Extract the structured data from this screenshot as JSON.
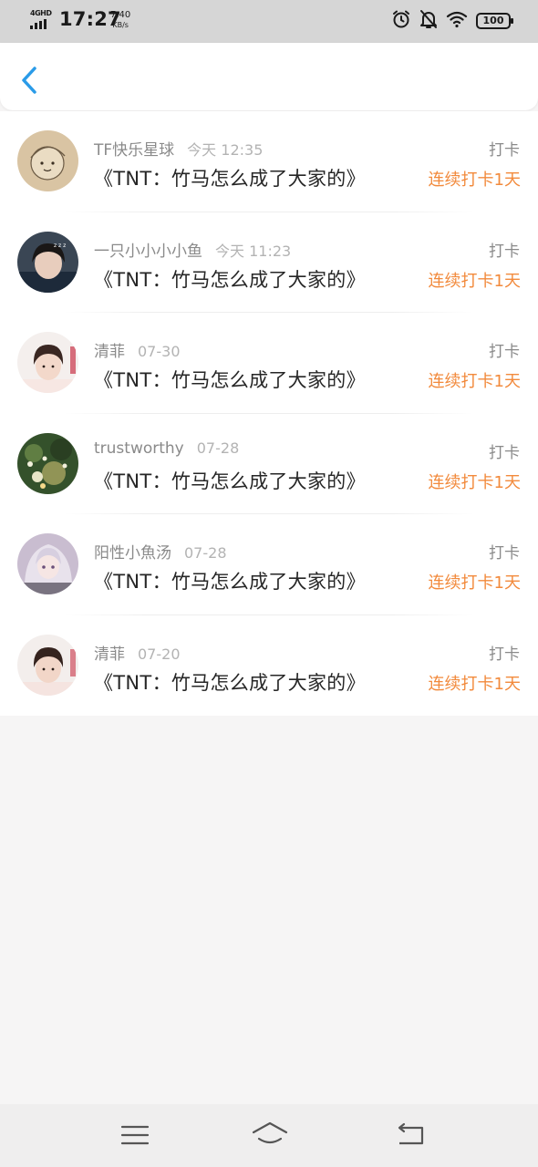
{
  "status_bar": {
    "network": "4GHD",
    "time": "17:27",
    "speed_value": "7.40",
    "speed_unit": "KB/s",
    "battery": "100",
    "icons": [
      "alarm-icon",
      "bell-off-icon",
      "wifi-icon",
      "battery-icon"
    ]
  },
  "header": {
    "back_icon": "chevron-left-icon",
    "accent_color": "#2a9be8"
  },
  "entries": [
    {
      "user": "TF快乐星球",
      "time": "今天 12:35",
      "title": "《TNT：竹马怎么成了大家的》",
      "type": "打卡",
      "streak": "连续打卡1天"
    },
    {
      "user": "一只小小小小鱼",
      "time": "今天 11:23",
      "title": "《TNT：竹马怎么成了大家的》",
      "type": "打卡",
      "streak": "连续打卡1天"
    },
    {
      "user": "清菲",
      "time": "07-30",
      "title": "《TNT：竹马怎么成了大家的》",
      "type": "打卡",
      "streak": "连续打卡1天"
    },
    {
      "user": "trustworthy",
      "time": "07-28",
      "title": "《TNT：竹马怎么成了大家的》",
      "type": "打卡",
      "streak": "连续打卡1天"
    },
    {
      "user": "阳性小魚汤",
      "time": "07-28",
      "title": "《TNT：竹马怎么成了大家的》",
      "type": "打卡",
      "streak": "连续打卡1天"
    },
    {
      "user": "清菲",
      "time": "07-20",
      "title": "《TNT：竹马怎么成了大家的》",
      "type": "打卡",
      "streak": "连续打卡1天"
    }
  ],
  "colors": {
    "streak": "#f28a3c",
    "meta": "#8a8a8a",
    "title": "#262626"
  },
  "nav_bar": {
    "icons": [
      "menu-icon",
      "home-icon",
      "back-icon"
    ]
  }
}
